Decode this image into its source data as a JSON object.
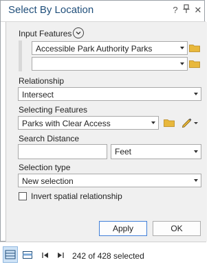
{
  "window": {
    "title": "Select By Location",
    "help_icon": "?",
    "pin_icon": "pin-icon",
    "close_icon": "✕"
  },
  "form": {
    "input_features_label": "Input Features",
    "input_features": [
      "Accessible Park Authority Parks",
      ""
    ],
    "relationship_label": "Relationship",
    "relationship_value": "Intersect",
    "selecting_features_label": "Selecting Features",
    "selecting_features_value": "Parks with Clear Access",
    "search_distance_label": "Search Distance",
    "search_distance_value": "",
    "search_distance_unit": "Feet",
    "selection_type_label": "Selection type",
    "selection_type_value": "New selection",
    "invert_label": "Invert spatial relationship",
    "invert_checked": false
  },
  "buttons": {
    "apply": "Apply",
    "ok": "OK"
  },
  "status": {
    "selection_text": "242 of 428 selected"
  },
  "colors": {
    "accent": "#3f7ed8",
    "title": "#1f4e7a",
    "folder": "#e8b83c"
  }
}
